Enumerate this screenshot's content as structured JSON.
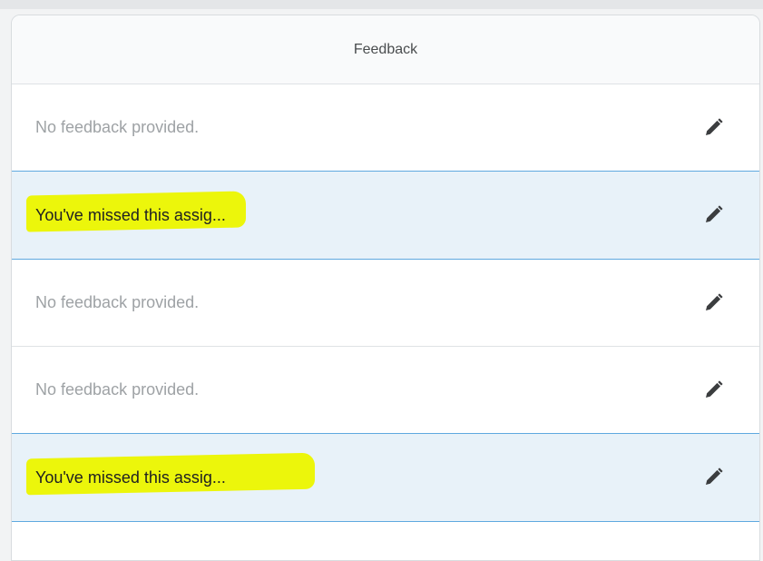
{
  "header": {
    "title": "Feedback"
  },
  "rows": [
    {
      "text": "No feedback provided.",
      "selected": false,
      "highlighted": false,
      "icon": "pencil-icon"
    },
    {
      "text": "You've missed this assig...",
      "selected": true,
      "highlighted": true,
      "icon": "pencil-icon"
    },
    {
      "text": "No feedback provided.",
      "selected": false,
      "highlighted": false,
      "icon": "pencil-icon"
    },
    {
      "text": "No feedback provided.",
      "selected": false,
      "highlighted": false,
      "icon": "pencil-icon"
    },
    {
      "text": "You've missed this assig...",
      "selected": true,
      "highlighted": true,
      "icon": "pencil-icon"
    }
  ],
  "colors": {
    "selected_background": "#e8f2f9",
    "selected_border": "#5fa9e0",
    "highlight": "#ecf60b",
    "placeholder_text": "#9ea2a5",
    "icon": "#3b3d3f"
  }
}
